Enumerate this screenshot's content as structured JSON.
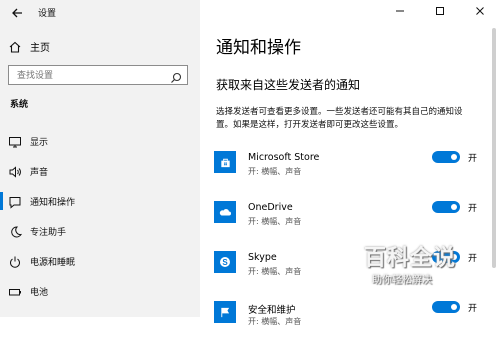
{
  "window": {
    "title": "设置"
  },
  "sidebar": {
    "home_label": "主页",
    "search_placeholder": "查找设置",
    "section_label": "系统",
    "items": [
      {
        "label": "显示",
        "icon": "display-icon"
      },
      {
        "label": "声音",
        "icon": "sound-icon"
      },
      {
        "label": "通知和操作",
        "icon": "notification-icon",
        "active": true
      },
      {
        "label": "专注助手",
        "icon": "moon-icon"
      },
      {
        "label": "电源和睡眠",
        "icon": "power-icon"
      },
      {
        "label": "电池",
        "icon": "battery-icon"
      }
    ]
  },
  "main": {
    "title": "通知和操作",
    "subheading": "获取来自这些发送者的通知",
    "description": "选择发送者可查看更多设置。一些发送者还可能有其自己的通知设置。如果是这样，打开发送者即可更改这些设置。",
    "apps": [
      {
        "name": "Microsoft Store",
        "detail": "开: 横幅、声音",
        "toggle_label": "开",
        "icon": "store-icon"
      },
      {
        "name": "OneDrive",
        "detail": "开: 横幅、声音",
        "toggle_label": "开",
        "icon": "cloud-icon"
      },
      {
        "name": "Skype",
        "detail": "开: 横幅、声音",
        "toggle_label": "开",
        "icon": "skype-icon"
      },
      {
        "name": "安全和维护",
        "detail": "开: 横幅、声音",
        "toggle_label": "开",
        "icon": "flag-icon"
      }
    ]
  },
  "watermark": {
    "title": "百科全说",
    "subtitle": "助你轻松解决"
  },
  "colors": {
    "accent": "#0078d7",
    "sidebar_bg": "#f2f2f2"
  }
}
